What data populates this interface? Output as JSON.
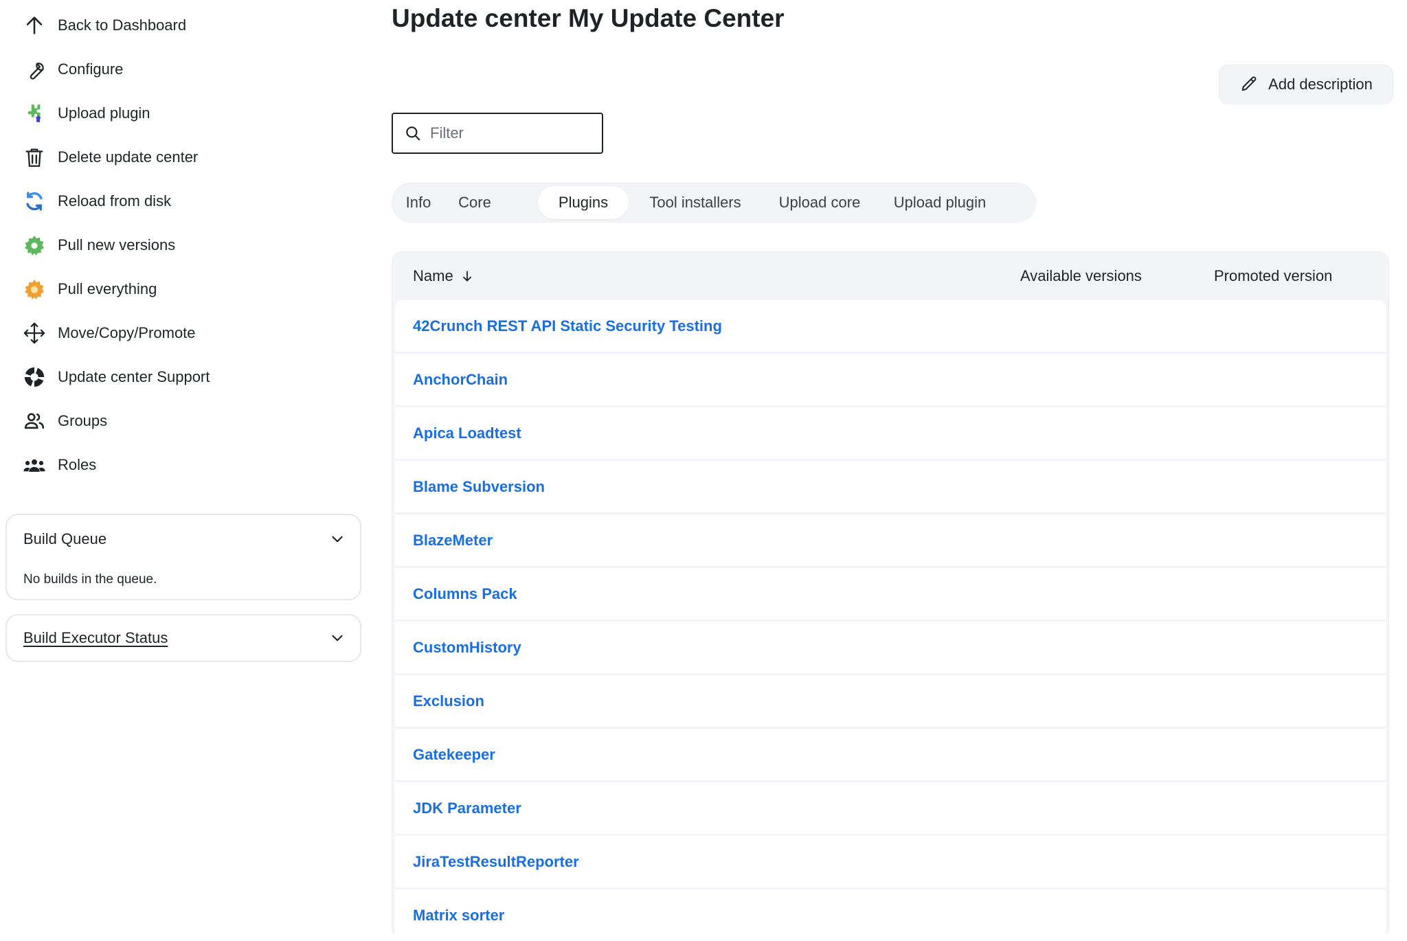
{
  "sidebar": {
    "items": [
      {
        "label": "Back to Dashboard",
        "icon": "arrow-up-icon"
      },
      {
        "label": "Configure",
        "icon": "wrench-icon"
      },
      {
        "label": "Upload plugin",
        "icon": "puzzle-piece-icon"
      },
      {
        "label": "Delete update center",
        "icon": "trash-icon"
      },
      {
        "label": "Reload from disk",
        "icon": "reload-icon"
      },
      {
        "label": "Pull new versions",
        "icon": "green-gear-icon"
      },
      {
        "label": "Pull everything",
        "icon": "orange-gear-icon"
      },
      {
        "label": "Move/Copy/Promote",
        "icon": "move-arrows-icon"
      },
      {
        "label": "Update center Support",
        "icon": "lifebuoy-icon"
      },
      {
        "label": "Groups",
        "icon": "group-icon"
      },
      {
        "label": "Roles",
        "icon": "roles-icon"
      }
    ],
    "build_queue": {
      "title": "Build Queue",
      "message": "No builds in the queue."
    },
    "build_executor": {
      "title": "Build Executor Status"
    }
  },
  "main": {
    "title": "Update center My Update Center",
    "add_description": "Add description",
    "filter": {
      "placeholder": "Filter",
      "value": ""
    },
    "tabs": [
      {
        "label": "Info"
      },
      {
        "label": "Core"
      },
      {
        "label": "Plugins",
        "active": true
      },
      {
        "label": "Tool installers"
      },
      {
        "label": "Upload core"
      },
      {
        "label": "Upload plugin"
      }
    ],
    "table": {
      "columns": [
        "Name",
        "Available versions",
        "Promoted version"
      ],
      "sort_indicator": "arrow-down-icon",
      "rows": [
        "42Crunch REST API Static Security Testing",
        "AnchorChain",
        "Apica Loadtest",
        "Blame Subversion",
        "BlazeMeter",
        "Columns Pack",
        "CustomHistory",
        "Exclusion",
        "Gatekeeper",
        "JDK Parameter",
        "JiraTestResultReporter",
        "Matrix sorter"
      ]
    }
  },
  "colors": {
    "link": "#1a6fe0",
    "text": "#1f2328",
    "panel_bg": "#f3f4f7",
    "icon_green": "#5cb85c",
    "icon_orange": "#f0a030"
  }
}
